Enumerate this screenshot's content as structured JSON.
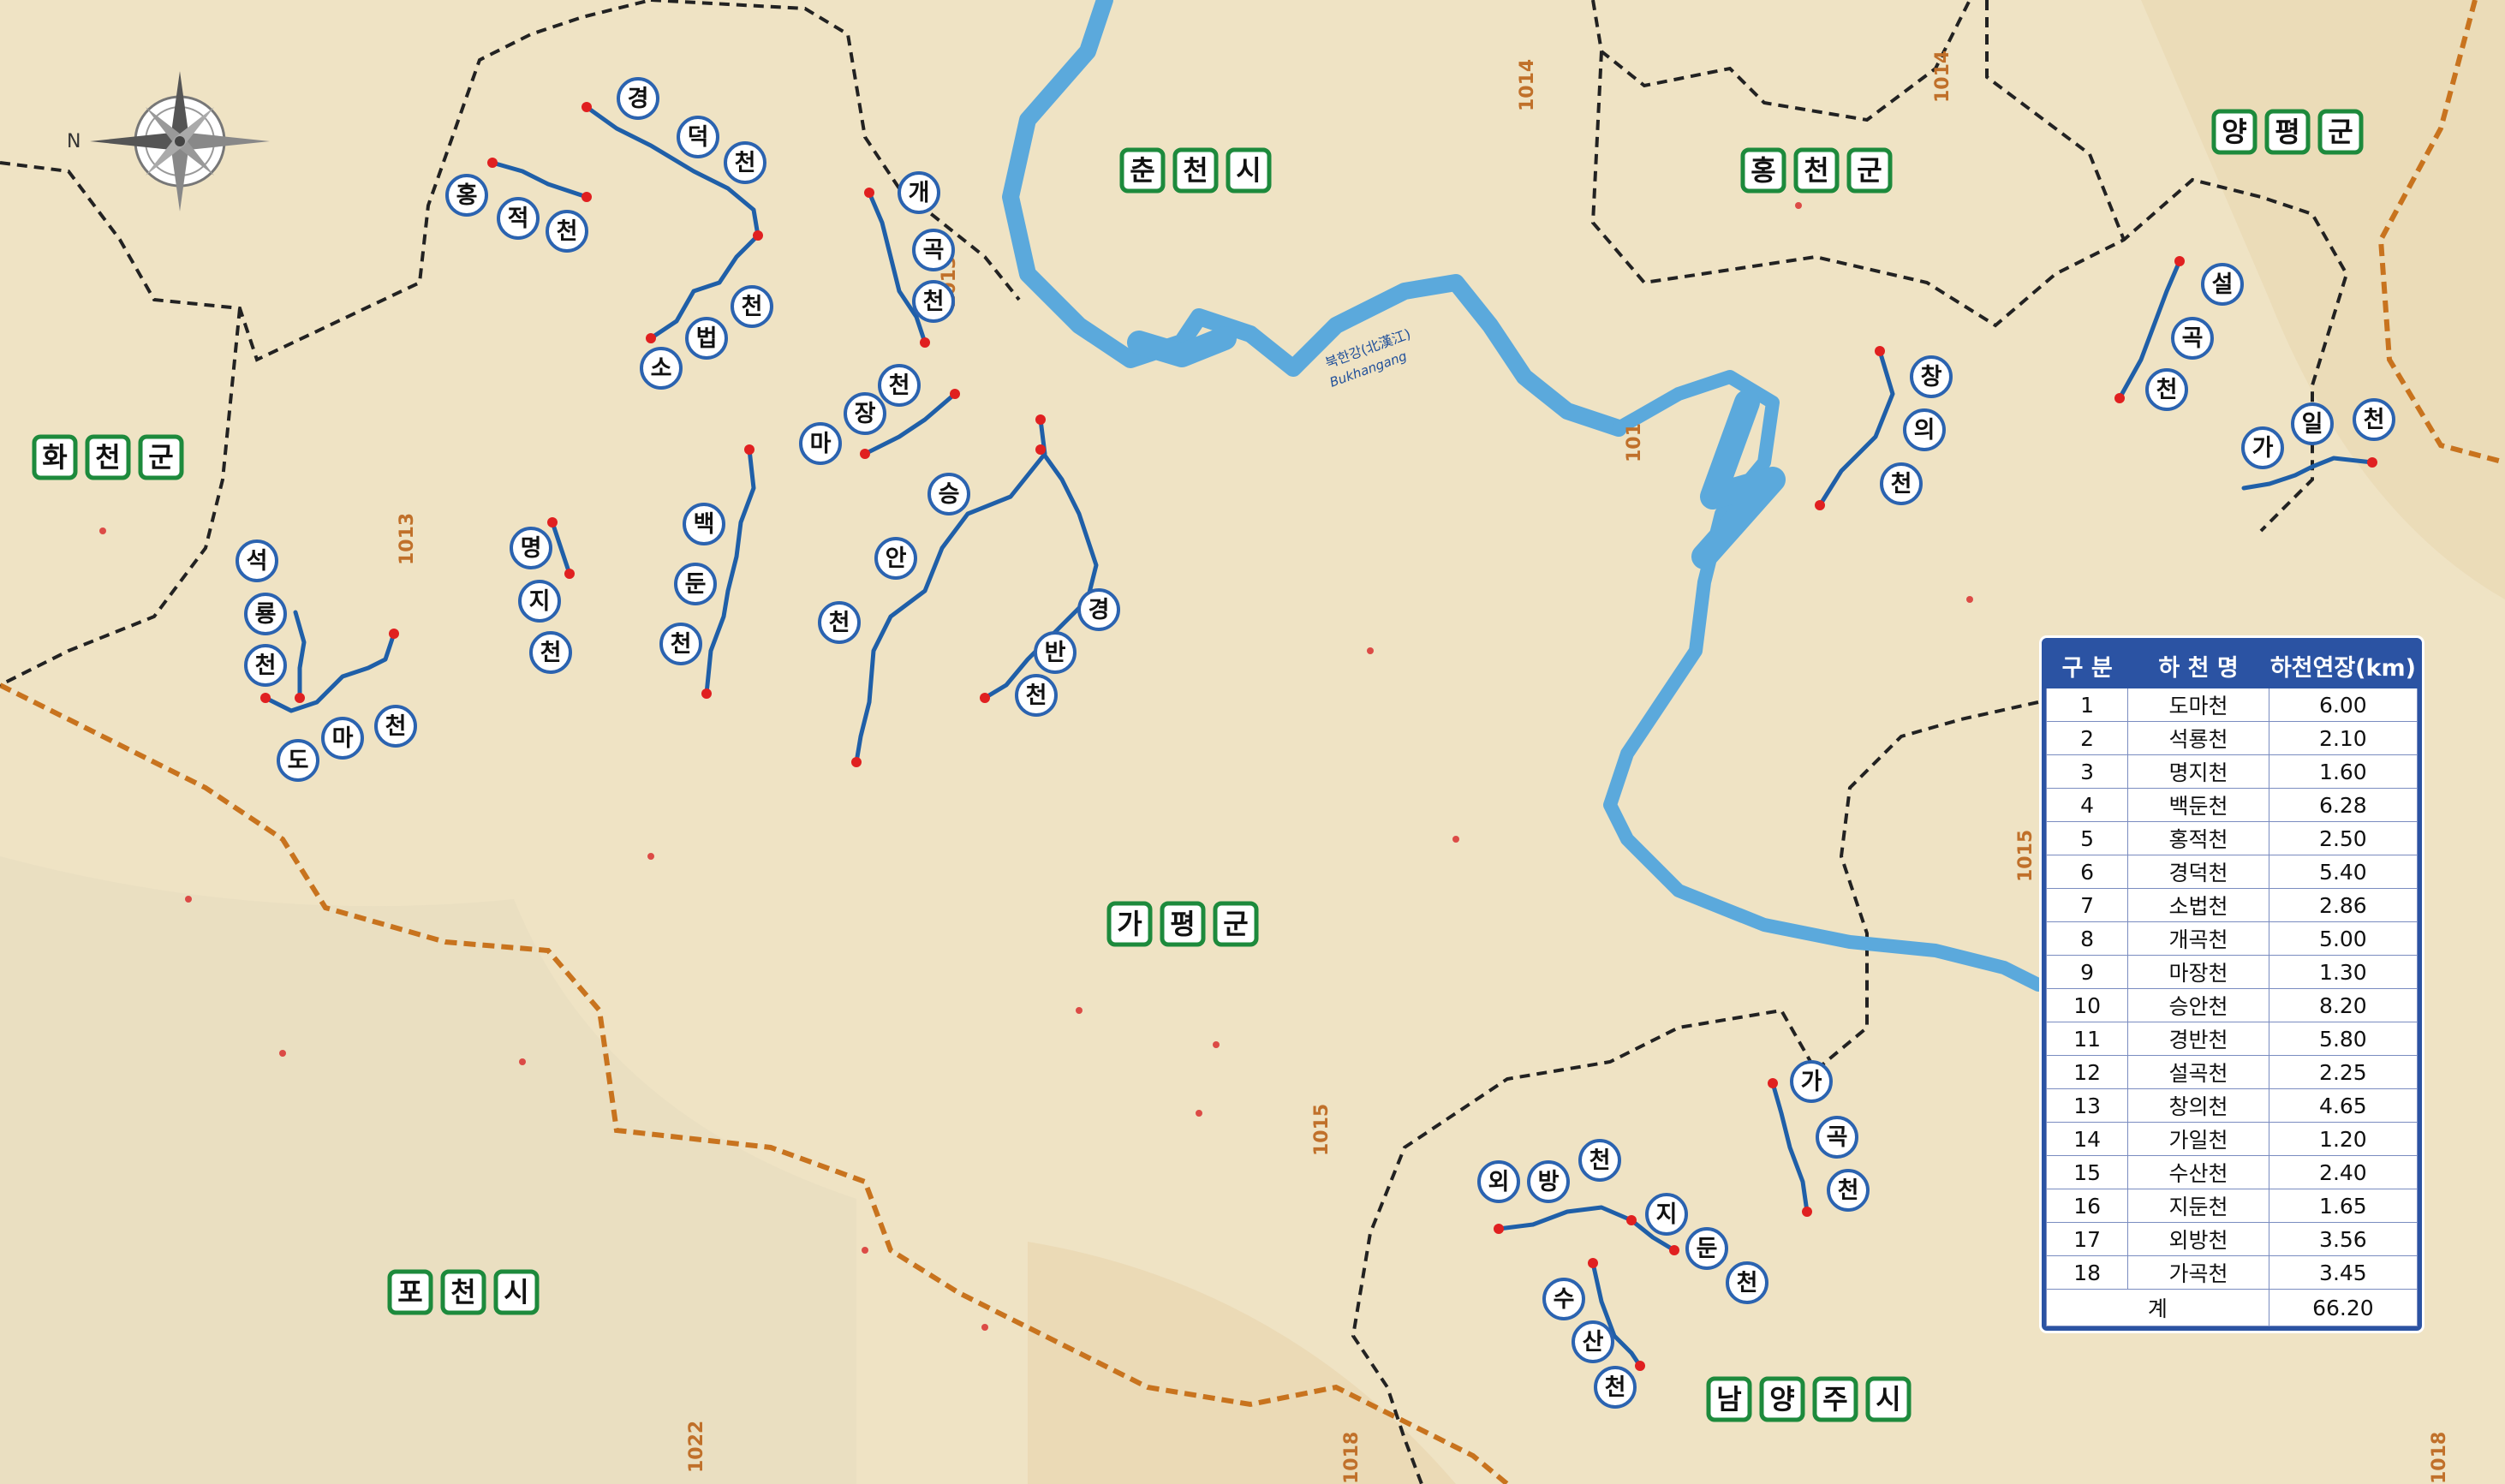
{
  "regions": [
    {
      "id": "chuncheon",
      "chars": [
        "춘",
        "천",
        "시"
      ]
    },
    {
      "id": "hongcheon",
      "chars": [
        "홍",
        "천",
        "군"
      ]
    },
    {
      "id": "yangpyeong",
      "chars": [
        "양",
        "평",
        "군"
      ]
    },
    {
      "id": "hwacheon",
      "chars": [
        "화",
        "천",
        "군"
      ]
    },
    {
      "id": "gapyeong",
      "chars": [
        "가",
        "평",
        "군"
      ]
    },
    {
      "id": "pocheon",
      "chars": [
        "포",
        "천",
        "시"
      ]
    },
    {
      "id": "namyangju",
      "chars": [
        "남",
        "양",
        "주",
        "시"
      ]
    }
  ],
  "stream_labels": [
    {
      "id": "gyeongdeok",
      "chars": [
        "경",
        "덕",
        "천"
      ]
    },
    {
      "id": "hongjeok",
      "chars": [
        "홍",
        "적",
        "천"
      ]
    },
    {
      "id": "sobeop",
      "chars": [
        "소",
        "법",
        "천"
      ]
    },
    {
      "id": "gaegok",
      "chars": [
        "개",
        "곡",
        "천"
      ]
    },
    {
      "id": "majang",
      "chars": [
        "마",
        "장",
        "천"
      ]
    },
    {
      "id": "seungan",
      "chars": [
        "승",
        "안",
        "천"
      ]
    },
    {
      "id": "gyeongban",
      "chars": [
        "경",
        "반",
        "천"
      ]
    },
    {
      "id": "baekdun",
      "chars": [
        "백",
        "둔",
        "천"
      ]
    },
    {
      "id": "myeongji",
      "chars": [
        "명",
        "지",
        "천"
      ]
    },
    {
      "id": "seokryong",
      "chars": [
        "석",
        "룡",
        "천"
      ]
    },
    {
      "id": "doma",
      "chars": [
        "도",
        "마",
        "천"
      ]
    },
    {
      "id": "changui",
      "chars": [
        "창",
        "의",
        "천"
      ]
    },
    {
      "id": "seolgok",
      "chars": [
        "설",
        "곡",
        "천"
      ]
    },
    {
      "id": "gail",
      "chars": [
        "가",
        "일",
        "천"
      ]
    },
    {
      "id": "wabang",
      "chars": [
        "외",
        "방",
        "천"
      ]
    },
    {
      "id": "jidun",
      "chars": [
        "지",
        "둔",
        "천"
      ]
    },
    {
      "id": "susan",
      "chars": [
        "수",
        "산",
        "천"
      ]
    },
    {
      "id": "gagok",
      "chars": [
        "가",
        "곡",
        "천"
      ]
    }
  ],
  "road_numbers": [
    "1014",
    "1014",
    "1013",
    "1013",
    "1015",
    "1015",
    "1022",
    "1018",
    "1018",
    "101"
  ],
  "river": {
    "name_kr": "북한강(北漢江)",
    "name_en": "Bukhangang"
  },
  "compass": {
    "north_label": "N",
    "icon": "compass-rose-icon"
  },
  "colors": {
    "river": "#5ba9dc",
    "stream": "#1f5fa8",
    "label_border": "#2b63b0",
    "region_bg": "#1d8a3c",
    "boundary_gun": "#222222",
    "boundary_do": "#c8731e"
  },
  "table": {
    "headers": [
      "구 분",
      "하 천 명",
      "하천연장(km)"
    ],
    "rows": [
      [
        "1",
        "도마천",
        "6.00"
      ],
      [
        "2",
        "석룡천",
        "2.10"
      ],
      [
        "3",
        "명지천",
        "1.60"
      ],
      [
        "4",
        "백둔천",
        "6.28"
      ],
      [
        "5",
        "홍적천",
        "2.50"
      ],
      [
        "6",
        "경덕천",
        "5.40"
      ],
      [
        "7",
        "소법천",
        "2.86"
      ],
      [
        "8",
        "개곡천",
        "5.00"
      ],
      [
        "9",
        "마장천",
        "1.30"
      ],
      [
        "10",
        "승안천",
        "8.20"
      ],
      [
        "11",
        "경반천",
        "5.80"
      ],
      [
        "12",
        "설곡천",
        "2.25"
      ],
      [
        "13",
        "창의천",
        "4.65"
      ],
      [
        "14",
        "가일천",
        "1.20"
      ],
      [
        "15",
        "수산천",
        "2.40"
      ],
      [
        "16",
        "지둔천",
        "1.65"
      ],
      [
        "17",
        "외방천",
        "3.56"
      ],
      [
        "18",
        "가곡천",
        "3.45"
      ]
    ],
    "total": {
      "label": "계",
      "value": "66.20"
    }
  }
}
